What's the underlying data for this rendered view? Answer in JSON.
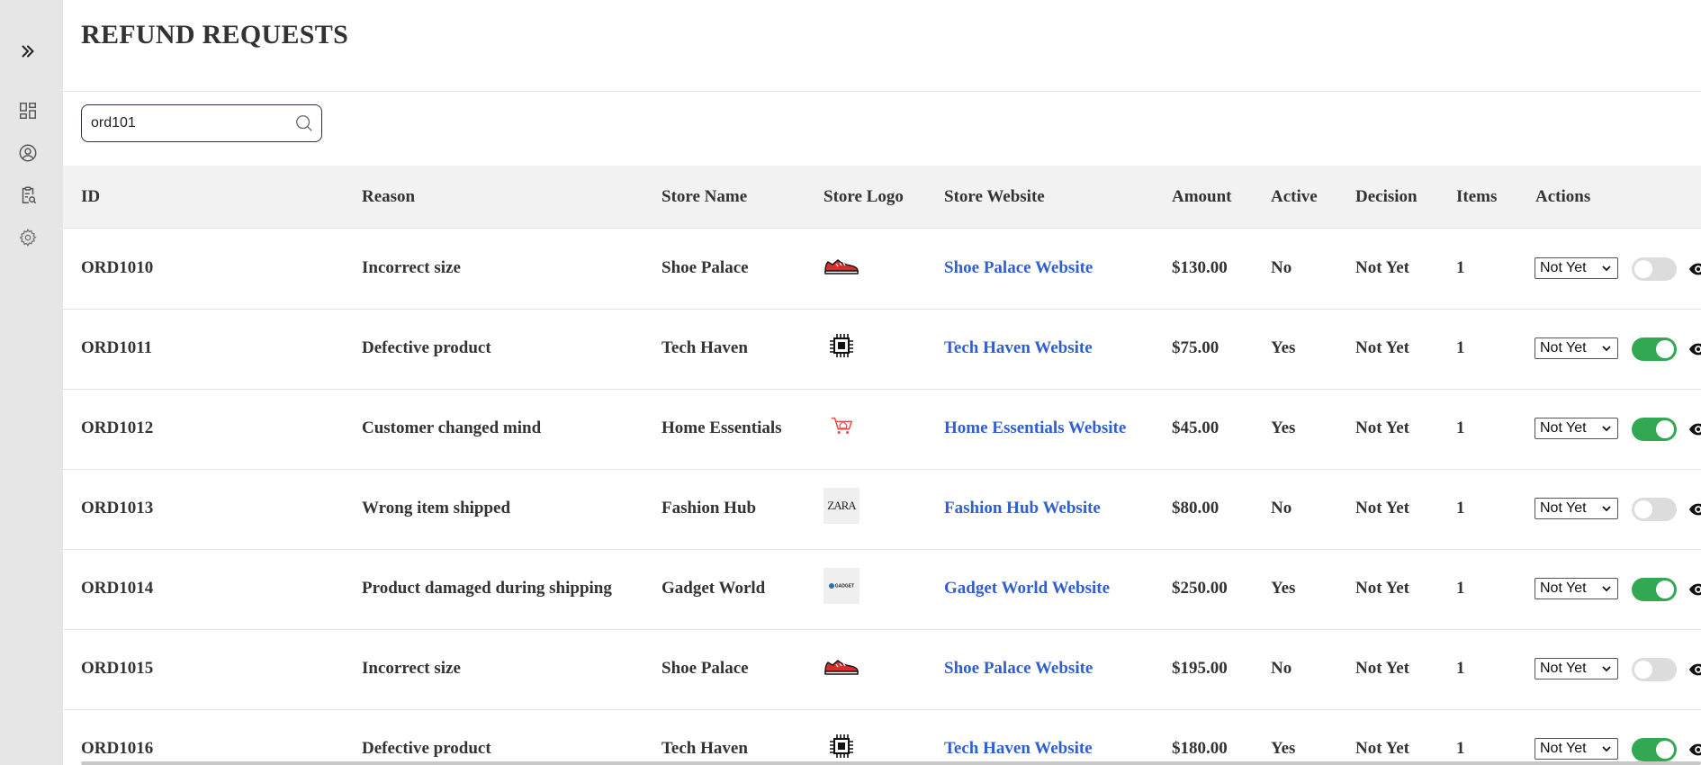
{
  "sidebar": {
    "items": [
      {
        "icon": "chevrons-right-icon"
      },
      {
        "icon": "dashboard-icon"
      },
      {
        "icon": "user-circle-icon"
      },
      {
        "icon": "clipboard-search-icon"
      },
      {
        "icon": "gear-icon"
      }
    ]
  },
  "page": {
    "title": "REFUND REQUESTS"
  },
  "search": {
    "value": "ord101",
    "placeholder": ""
  },
  "table": {
    "headers": {
      "id": "ID",
      "reason": "Reason",
      "store_name": "Store Name",
      "store_logo": "Store Logo",
      "store_website": "Store Website",
      "amount": "Amount",
      "active": "Active",
      "decision": "Decision",
      "items": "Items",
      "actions": "Actions"
    },
    "rows": [
      {
        "id": "ORD1010",
        "reason": "Incorrect size",
        "store_name": "Shoe Palace",
        "logo": "sneaker-logo",
        "website": "Shoe Palace Website",
        "amount": "$130.00",
        "active": "No",
        "decision": "Not Yet",
        "items": "1",
        "select_value": "Not Yet",
        "toggle_on": false
      },
      {
        "id": "ORD1011",
        "reason": "Defective product",
        "store_name": "Tech Haven",
        "logo": "chip-logo",
        "website": "Tech Haven Website",
        "amount": "$75.00",
        "active": "Yes",
        "decision": "Not Yet",
        "items": "1",
        "select_value": "Not Yet",
        "toggle_on": true
      },
      {
        "id": "ORD1012",
        "reason": "Customer changed mind",
        "store_name": "Home Essentials",
        "logo": "cart-home-logo",
        "website": "Home Essentials Website",
        "amount": "$45.00",
        "active": "Yes",
        "decision": "Not Yet",
        "items": "1",
        "select_value": "Not Yet",
        "toggle_on": true
      },
      {
        "id": "ORD1013",
        "reason": "Wrong item shipped",
        "store_name": "Fashion Hub",
        "logo": "zara-logo",
        "logo_text": "ZARA",
        "website": "Fashion Hub Website",
        "amount": "$80.00",
        "active": "No",
        "decision": "Not Yet",
        "items": "1",
        "select_value": "Not Yet",
        "toggle_on": false
      },
      {
        "id": "ORD1014",
        "reason": "Product damaged during shipping",
        "store_name": "Gadget World",
        "logo": "gadget-logo",
        "logo_text": "GADGET",
        "website": "Gadget World Website",
        "amount": "$250.00",
        "active": "Yes",
        "decision": "Not Yet",
        "items": "1",
        "select_value": "Not Yet",
        "toggle_on": true
      },
      {
        "id": "ORD1015",
        "reason": "Incorrect size",
        "store_name": "Shoe Palace",
        "logo": "sneaker-logo",
        "website": "Shoe Palace Website",
        "amount": "$195.00",
        "active": "No",
        "decision": "Not Yet",
        "items": "1",
        "select_value": "Not Yet",
        "toggle_on": false
      },
      {
        "id": "ORD1016",
        "reason": "Defective product",
        "store_name": "Tech Haven",
        "logo": "chip-logo",
        "website": "Tech Haven Website",
        "amount": "$180.00",
        "active": "Yes",
        "decision": "Not Yet",
        "items": "1",
        "select_value": "Not Yet",
        "toggle_on": true
      }
    ]
  },
  "colors": {
    "link": "#2f5fd0",
    "toggle_on": "#33a853",
    "toggle_off": "#dcdcdc",
    "sidebar_bg": "#e6e6e6",
    "header_bg": "#f2f2f2"
  }
}
